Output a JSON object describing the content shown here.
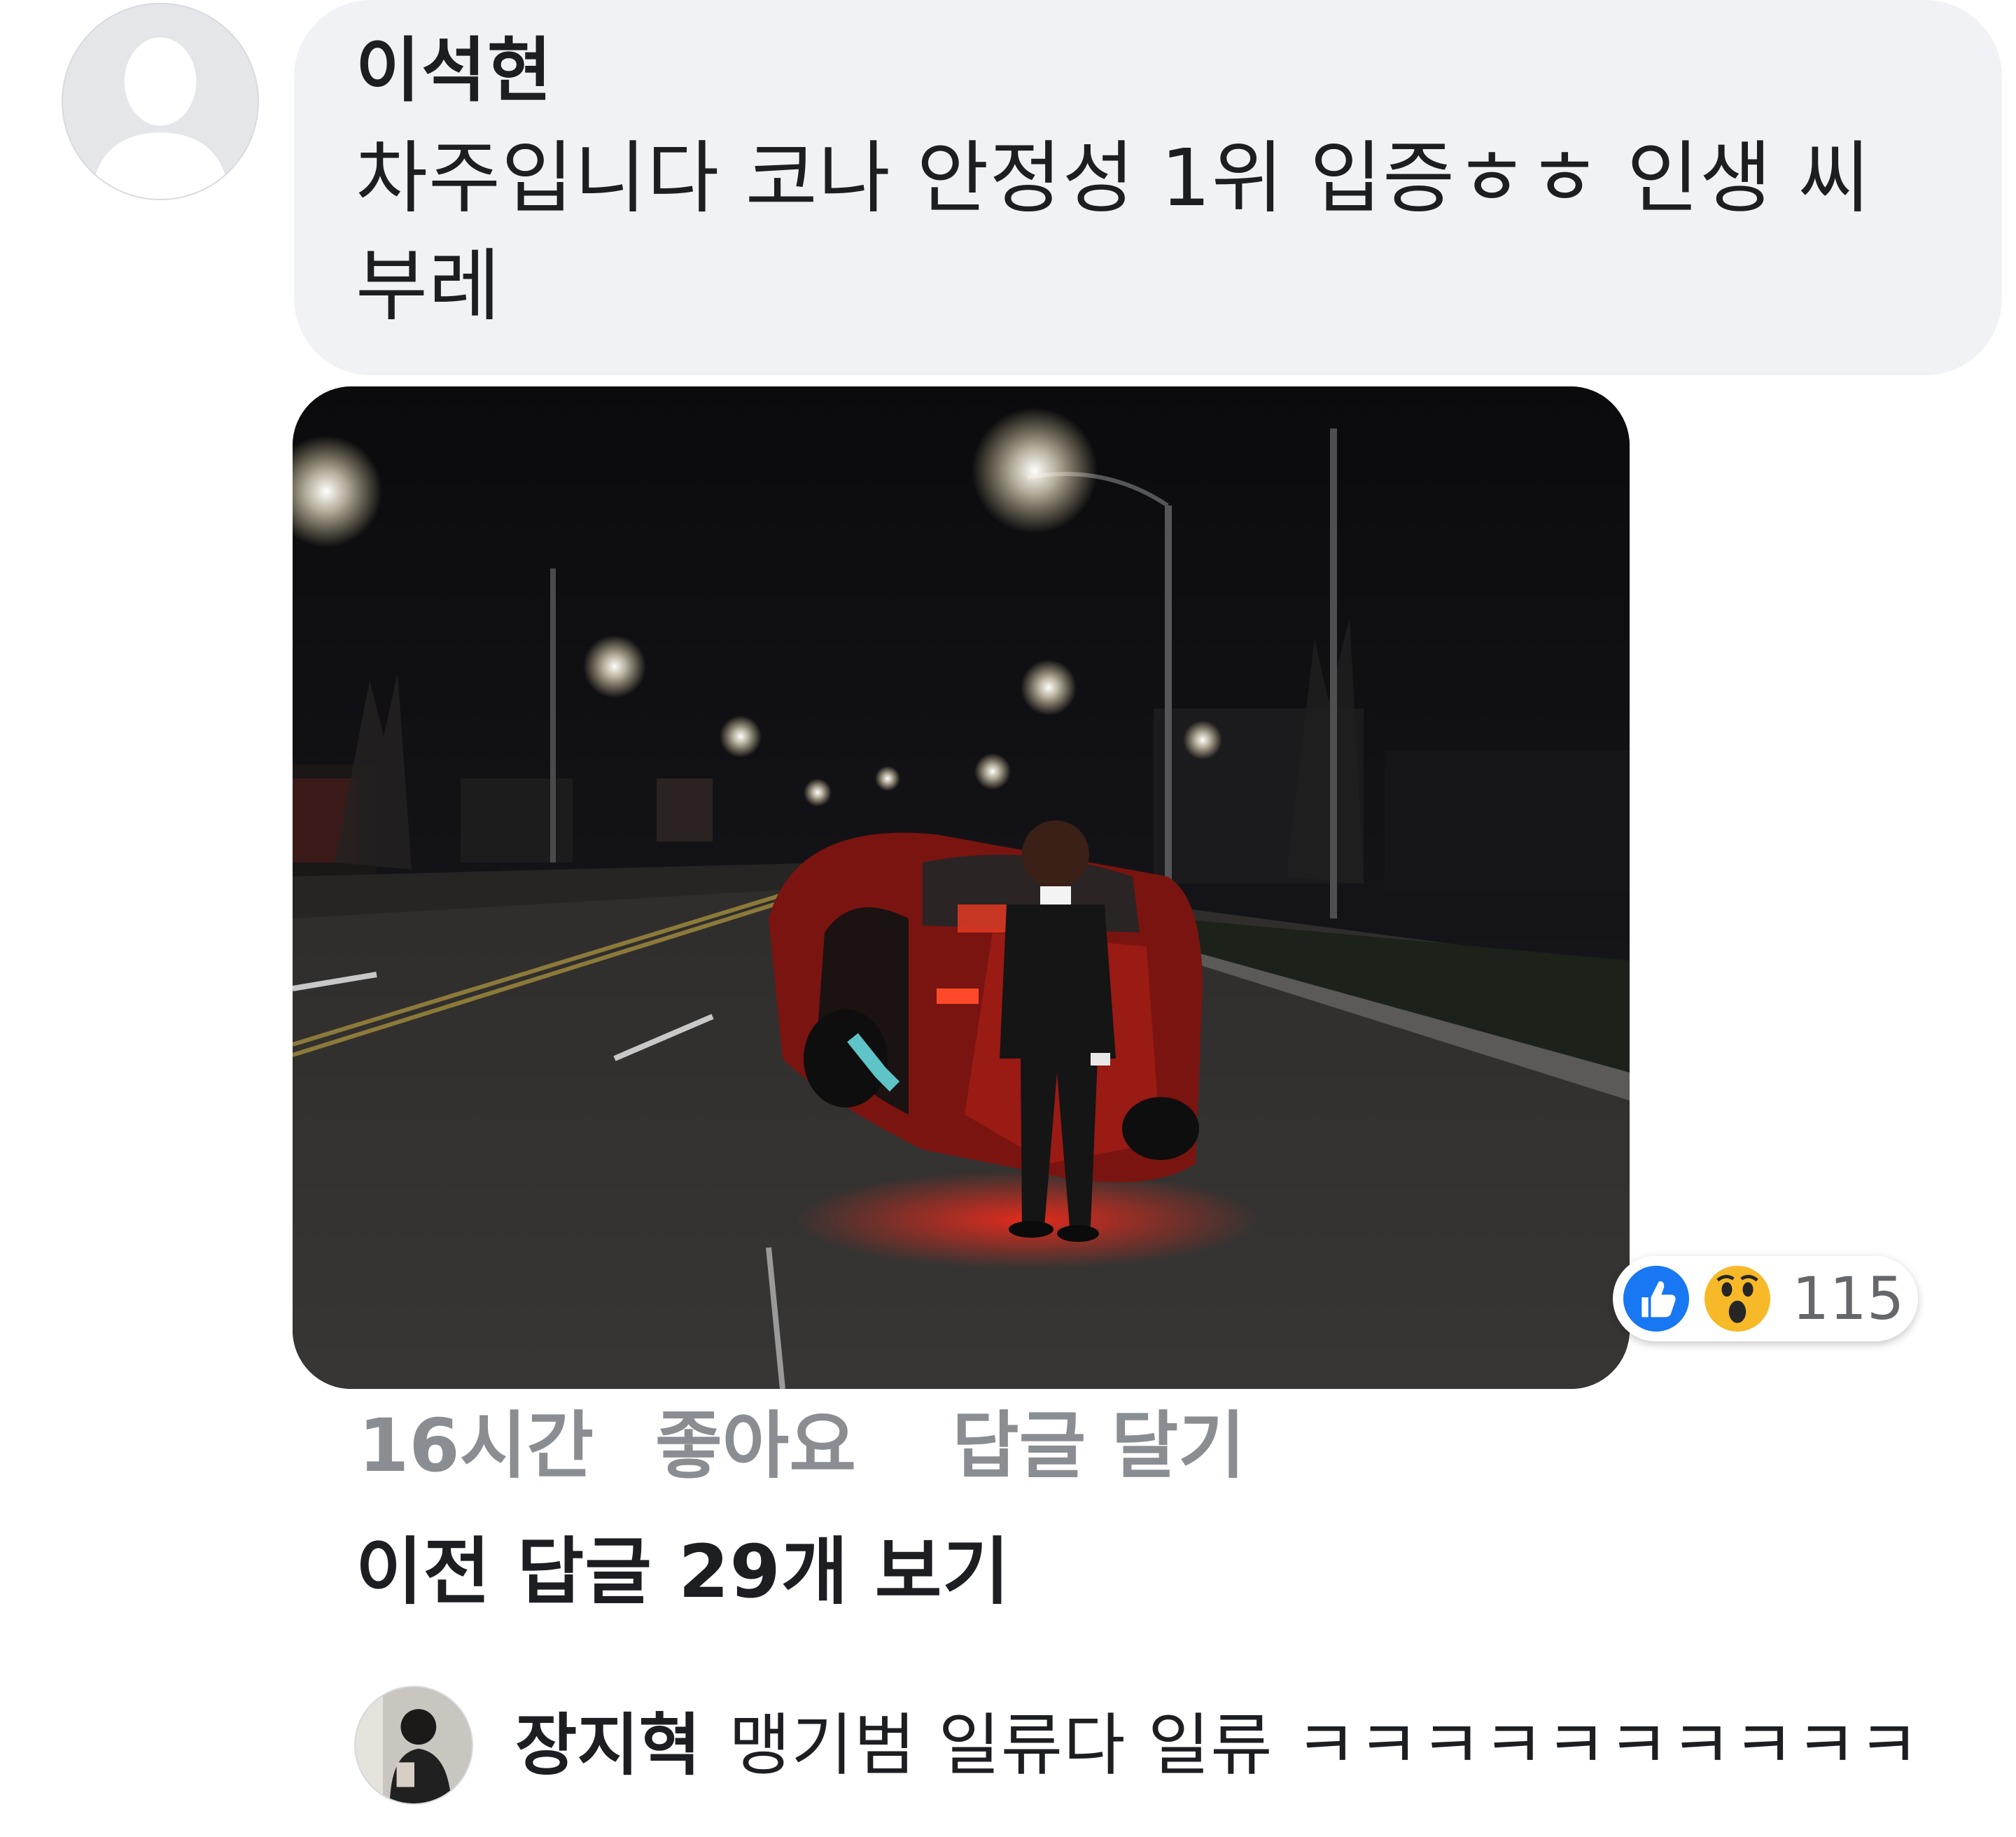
{
  "comment": {
    "author": "이석현",
    "text": "차주입니다 코나 안정성 1위 입증ㅎㅎ 인생 씨부레",
    "avatar_icon": "default-profile-silhouette-icon"
  },
  "photo": {
    "subject": "overturned red car on a night road with a man standing in front"
  },
  "reactions": {
    "icons": [
      "like-icon",
      "wow-icon"
    ],
    "count": "115",
    "like_color": "#1877f2",
    "wow_color": "#f7b928"
  },
  "actions": {
    "timestamp": "16시간",
    "like_label": "좋아요",
    "reply_label": "답글 달기"
  },
  "view_replies": {
    "label": "이전 답글 29개 보기"
  },
  "reply": {
    "author": "장지혁",
    "text": "맹기범 일류다 일류 ㅋㅋㅋㅋㅋㅋㅋㅋㅋㅋ"
  }
}
